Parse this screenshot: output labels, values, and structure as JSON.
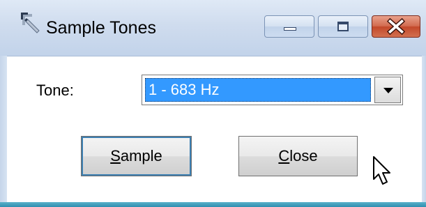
{
  "window": {
    "title": "Sample Tones",
    "app_icon": "pen-icon"
  },
  "caption_buttons": {
    "minimize_icon": "minimize-icon",
    "maximize_icon": "maximize-icon",
    "close_icon": "close-icon"
  },
  "form": {
    "tone_label": "Tone:",
    "tone_selected": "1 - 683 Hz",
    "dropdown_icon": "chevron-down-icon"
  },
  "buttons": {
    "sample_access_key": "S",
    "sample_rest": "ample",
    "close_access_key": "C",
    "close_rest": "lose"
  },
  "colors": {
    "selection": "#3399ff",
    "close_button": "#c3482a",
    "title_bar": "#cfdcee"
  }
}
